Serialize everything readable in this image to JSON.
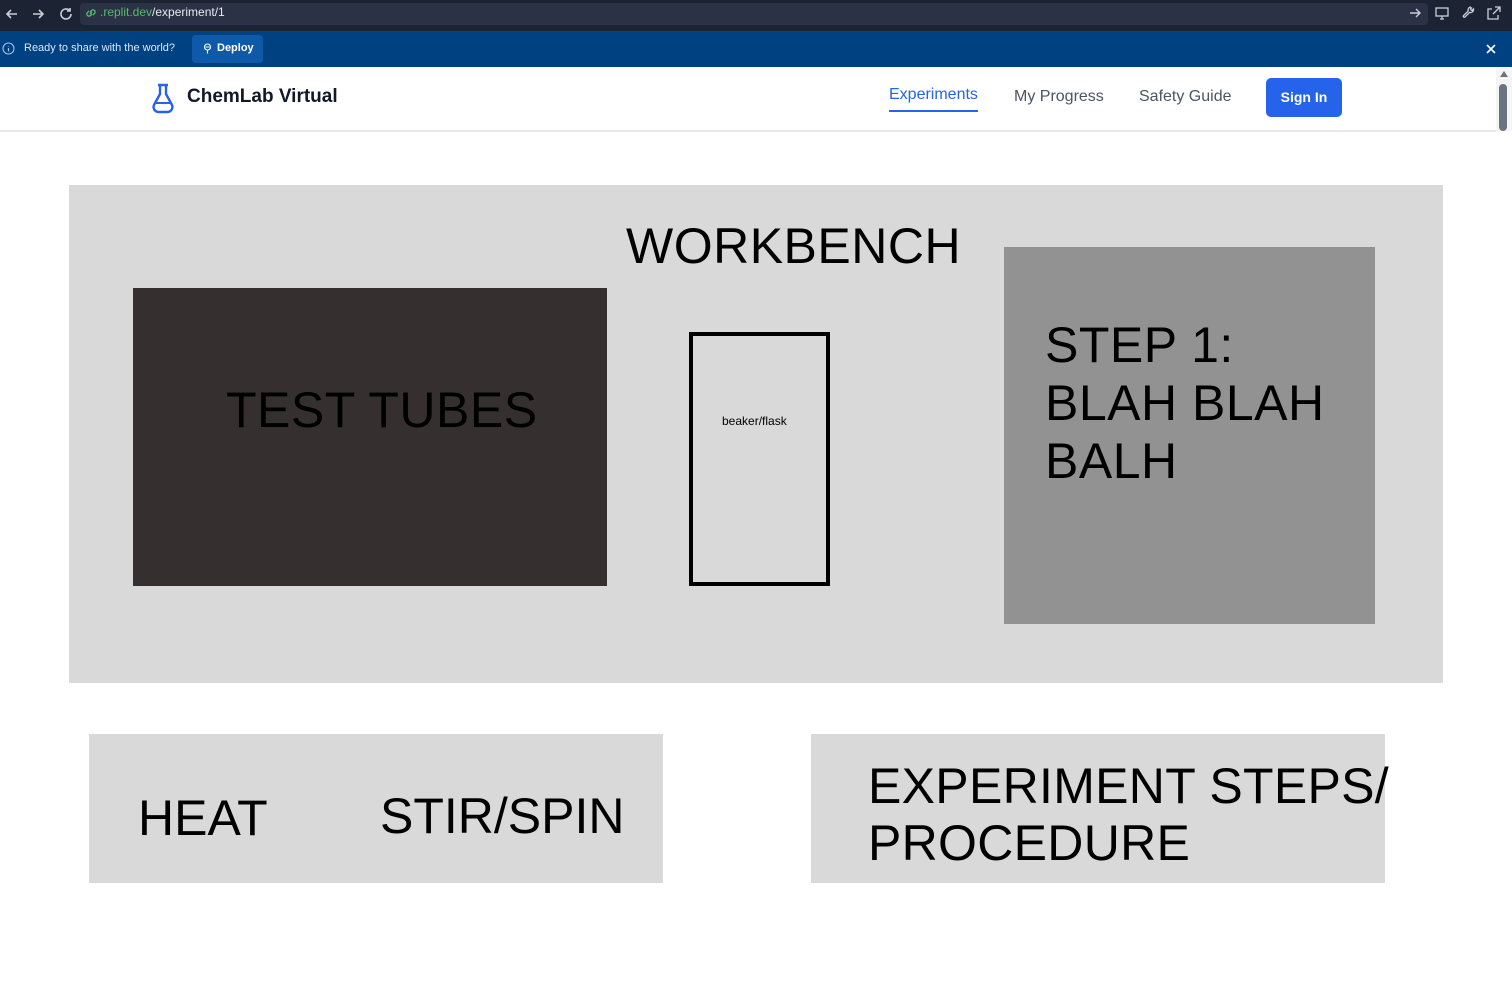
{
  "browser": {
    "url_host": ".replit.dev",
    "url_path": "/experiment/1",
    "icons": [
      "back-arrow-icon",
      "forward-arrow-icon",
      "reload-icon",
      "link-icon",
      "arrow-right-icon",
      "monitor-icon",
      "wrench-icon",
      "external-link-icon"
    ]
  },
  "banner": {
    "message": "Ready to share with the world?",
    "deploy_label": "Deploy",
    "color": "#004182"
  },
  "header": {
    "brand": "ChemLab Virtual",
    "nav": [
      {
        "label": "Experiments",
        "active": true
      },
      {
        "label": "My Progress",
        "active": false
      },
      {
        "label": "Safety Guide",
        "active": false
      }
    ],
    "signin_label": "Sign In",
    "accent_color": "#2563eb"
  },
  "workbench": {
    "title": "WORKBENCH",
    "test_tubes_label": "TEST TUBES",
    "beaker_label": "beaker/flask",
    "step_lines": [
      "STEP 1:",
      "BLAH BLAH",
      "BALH"
    ]
  },
  "controls": {
    "heat_label": "HEAT",
    "stir_label": "STIR/SPIN"
  },
  "procedure": {
    "lines": [
      "EXPERIMENT STEPS/",
      "PROCEDURE"
    ]
  }
}
